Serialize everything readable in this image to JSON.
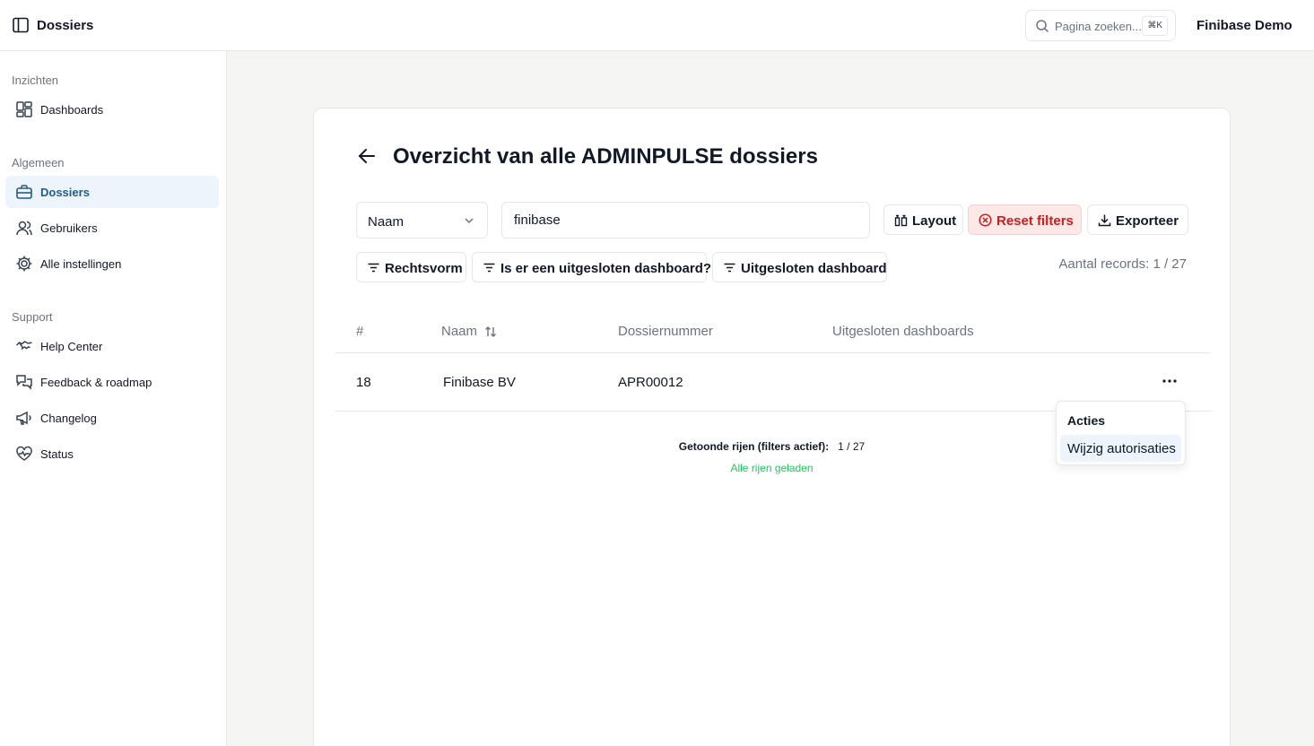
{
  "header": {
    "app_title": "Dossiers",
    "search_placeholder": "Pagina zoeken...",
    "search_shortcut": "⌘K",
    "org_name": "Finibase Demo"
  },
  "sidebar": {
    "groups": [
      {
        "label": "Inzichten",
        "items": [
          {
            "label": "Dashboards",
            "icon": "dashboard-grid-icon"
          }
        ]
      },
      {
        "label": "Algemeen",
        "items": [
          {
            "label": "Dossiers",
            "icon": "briefcase-icon",
            "active": true
          },
          {
            "label": "Gebruikers",
            "icon": "users-icon"
          },
          {
            "label": "Alle instellingen",
            "icon": "gear-icon"
          }
        ]
      },
      {
        "label": "Support",
        "items": [
          {
            "label": "Help Center",
            "icon": "handshake-icon"
          },
          {
            "label": "Feedback & roadmap",
            "icon": "chat-icon"
          },
          {
            "label": "Changelog",
            "icon": "megaphone-icon"
          },
          {
            "label": "Status",
            "icon": "heart-pulse-icon"
          }
        ]
      }
    ]
  },
  "page": {
    "title": "Overzicht van alle ADMINPULSE dossiers",
    "filter_field": "Naam",
    "filter_value": "finibase",
    "buttons": {
      "layout": "Layout",
      "reset": "Reset filters",
      "export": "Exporteer"
    },
    "filters": [
      "Rechtsvorm",
      "Is er een uitgesloten dashboard?",
      "Uitgesloten dashboard"
    ],
    "records_label": "Aantal records: 1 / 27"
  },
  "table": {
    "columns": [
      "#",
      "Naam",
      "Dossiernummer",
      "Uitgesloten dashboards"
    ],
    "rows": [
      {
        "num": "18",
        "name": "Finibase BV",
        "dossier": "APR00012",
        "excluded": ""
      }
    ]
  },
  "summary": {
    "rows_label": "Getoonde rijen (filters actief):",
    "rows_value": "1 / 27",
    "status": "Alle rijen geladen"
  },
  "menu": {
    "title": "Acties",
    "items": [
      "Wijzig autorisaties"
    ]
  },
  "colors": {
    "accent": "#1d5d8c",
    "active_bg": "#eef4fb",
    "danger": "#c81e1e",
    "success": "#22c55e"
  }
}
